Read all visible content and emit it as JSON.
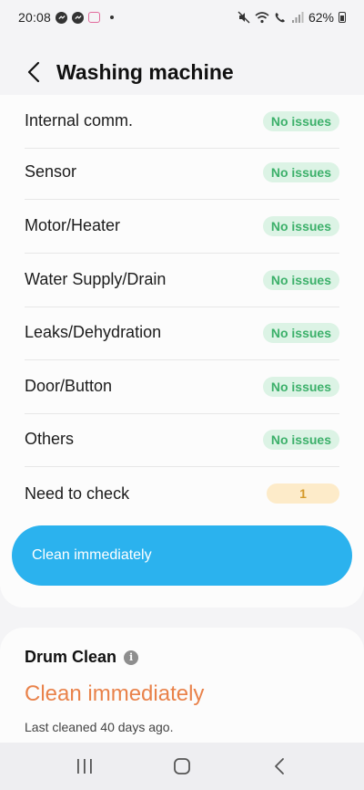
{
  "status_bar": {
    "time": "20:08",
    "battery": "62%"
  },
  "header": {
    "title": "Washing machine"
  },
  "diagnostics": [
    {
      "label": "Internal comm.",
      "status": "No issues",
      "state": "ok"
    },
    {
      "label": "Sensor",
      "status": "No issues",
      "state": "ok"
    },
    {
      "label": "Motor/Heater",
      "status": "No issues",
      "state": "ok"
    },
    {
      "label": "Water Supply/Drain",
      "status": "No issues",
      "state": "ok"
    },
    {
      "label": "Leaks/Dehydration",
      "status": "No issues",
      "state": "ok"
    },
    {
      "label": "Door/Button",
      "status": "No issues",
      "state": "ok"
    },
    {
      "label": "Others",
      "status": "No issues",
      "state": "ok"
    },
    {
      "label": "Need to check",
      "status": "1",
      "state": "warn"
    }
  ],
  "action_button": {
    "label": "Clean immediately"
  },
  "drum_clean": {
    "title": "Drum Clean",
    "status": "Clean immediately",
    "last_cleaned": "Last cleaned 40 days ago."
  },
  "colors": {
    "accent_blue": "#2bb2ee",
    "ok_green": "#3cb06a",
    "warn_orange": "#d59a2a",
    "drum_orange": "#e9824a"
  }
}
